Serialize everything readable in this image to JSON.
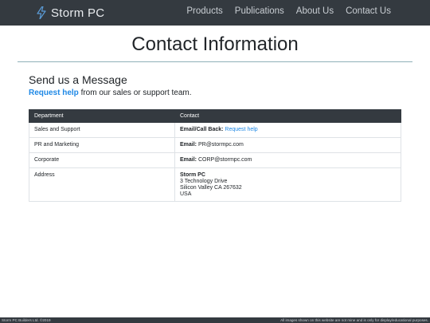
{
  "nav": {
    "brand": "Storm PC",
    "brand_icon": "lightning-bolt-icon",
    "links": [
      "Products",
      "Publications",
      "About Us",
      "Contact Us"
    ]
  },
  "page": {
    "title": "Contact Information"
  },
  "section": {
    "heading": "Send us a Message",
    "request_link": "Request help",
    "subtitle_rest": " from our sales or support team."
  },
  "table": {
    "headers": [
      "Department",
      "Contact"
    ],
    "rows": [
      {
        "department": "Sales and Support",
        "contact_label": "Email/Call Back:",
        "contact_value": "Request help"
      },
      {
        "department": "PR and Marketing",
        "contact_label": "Email:",
        "contact_value": "PR@stormpc.com"
      },
      {
        "department": "Corporate",
        "contact_label": "Email:",
        "contact_value": "CORP@stormpc.com"
      },
      {
        "department": "Address",
        "contact_label": "Storm PC",
        "address_lines": [
          "3 Technology Drive",
          "Silicon Valley CA 267632",
          "USA"
        ]
      }
    ]
  },
  "footer": {
    "left": "Storm PC Builders Ltd. ©2019",
    "right": "All images shown on this website are not mine and is only for display/educational purposes."
  },
  "colors": {
    "navbar_bg": "#343a40",
    "link_accent": "#1e88e5",
    "brand_icon": "#5b9bd5"
  }
}
